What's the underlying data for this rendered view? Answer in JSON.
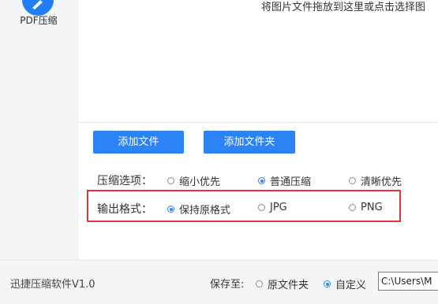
{
  "sidebar": {
    "items": [
      {
        "label": "PDF压缩",
        "icon": "edit-pen-icon"
      }
    ]
  },
  "drop_zone": {
    "hint": "将图片文件拖放到这里或点击选择图"
  },
  "actions": {
    "add_file": "添加文件",
    "add_folder": "添加文件夹"
  },
  "compress_options": {
    "label": "压缩选项：",
    "options": [
      "缩小优先",
      "普通压缩",
      "清晰优先"
    ],
    "selected": "普通压缩"
  },
  "output_format": {
    "label": "输出格式：",
    "options": [
      "保持原格式",
      "JPG",
      "PNG"
    ],
    "selected": "保持原格式"
  },
  "footer": {
    "version": "迅捷压缩软件V1.0",
    "save_to_label": "保存至:",
    "save_options": [
      "原文件夹",
      "自定义"
    ],
    "save_selected": "自定义",
    "path_value": "C:\\Users\\M"
  },
  "colors": {
    "accent": "#2b83f6",
    "highlight": "#e0353b",
    "sidebar_bg": "#f4f5f7"
  }
}
